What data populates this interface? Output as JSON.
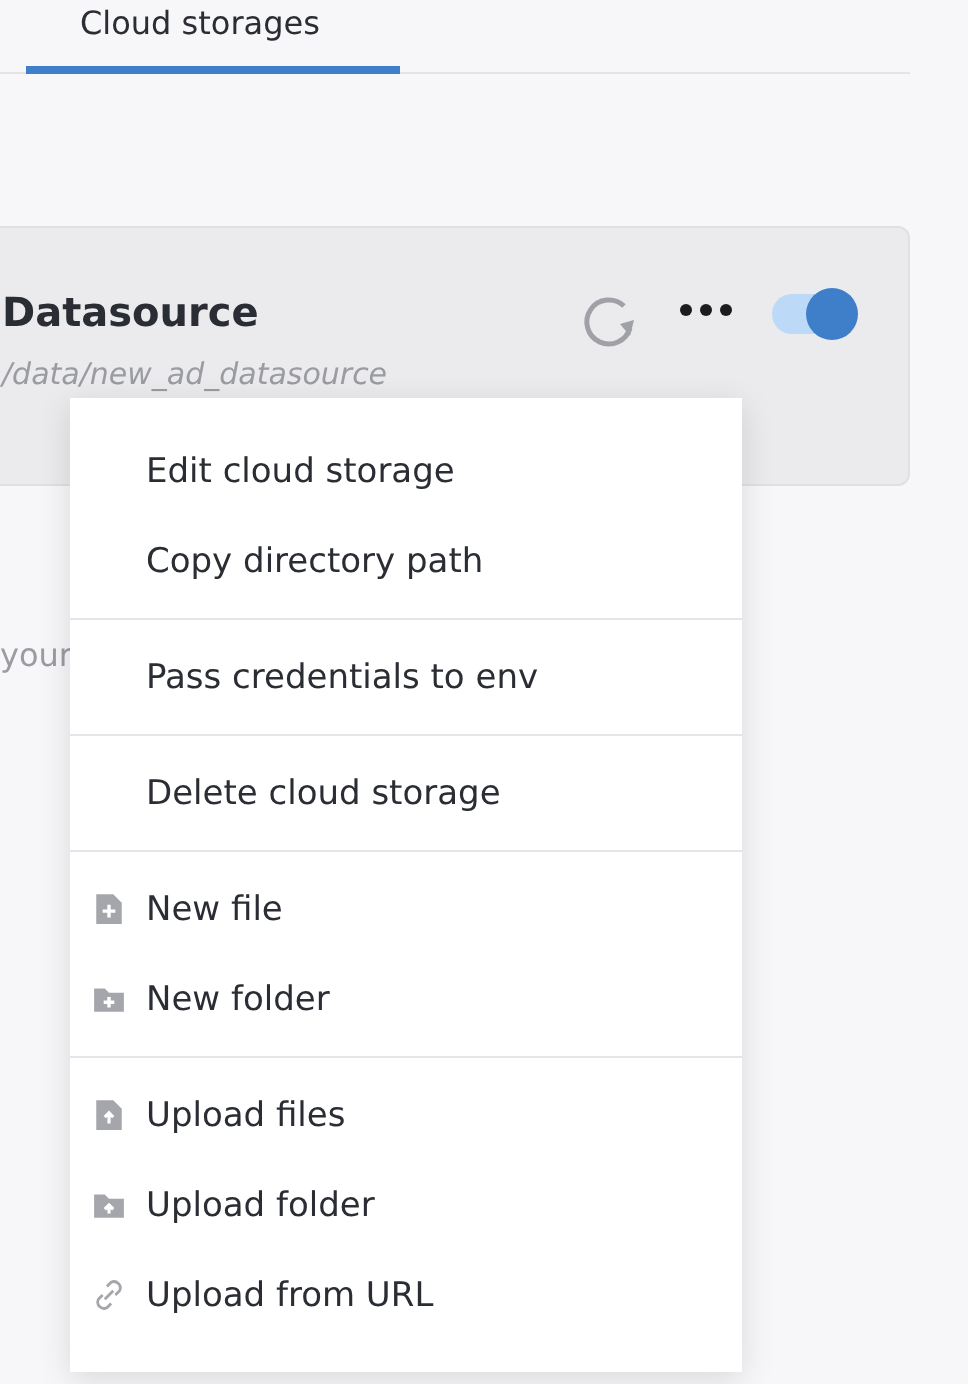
{
  "tabs": [
    {
      "label": "Cloud storages",
      "selected": true
    }
  ],
  "storage": {
    "name": "Datasource",
    "path": "/data/new_ad_datasource",
    "enabled": true
  },
  "hint": "your",
  "menu": {
    "groups": [
      [
        {
          "label": "Edit cloud storage",
          "kind": "plain"
        },
        {
          "label": "Copy directory path",
          "kind": "plain"
        }
      ],
      [
        {
          "label": "Pass credentials to env",
          "kind": "plain"
        }
      ],
      [
        {
          "label": "Delete cloud storage",
          "kind": "plain"
        }
      ],
      [
        {
          "label": "New file",
          "kind": "file-add"
        },
        {
          "label": "New folder",
          "kind": "folder-add"
        }
      ],
      [
        {
          "label": "Upload files",
          "kind": "file-upload"
        },
        {
          "label": "Upload folder",
          "kind": "folder-upload"
        },
        {
          "label": "Upload from URL",
          "kind": "link"
        }
      ]
    ]
  }
}
